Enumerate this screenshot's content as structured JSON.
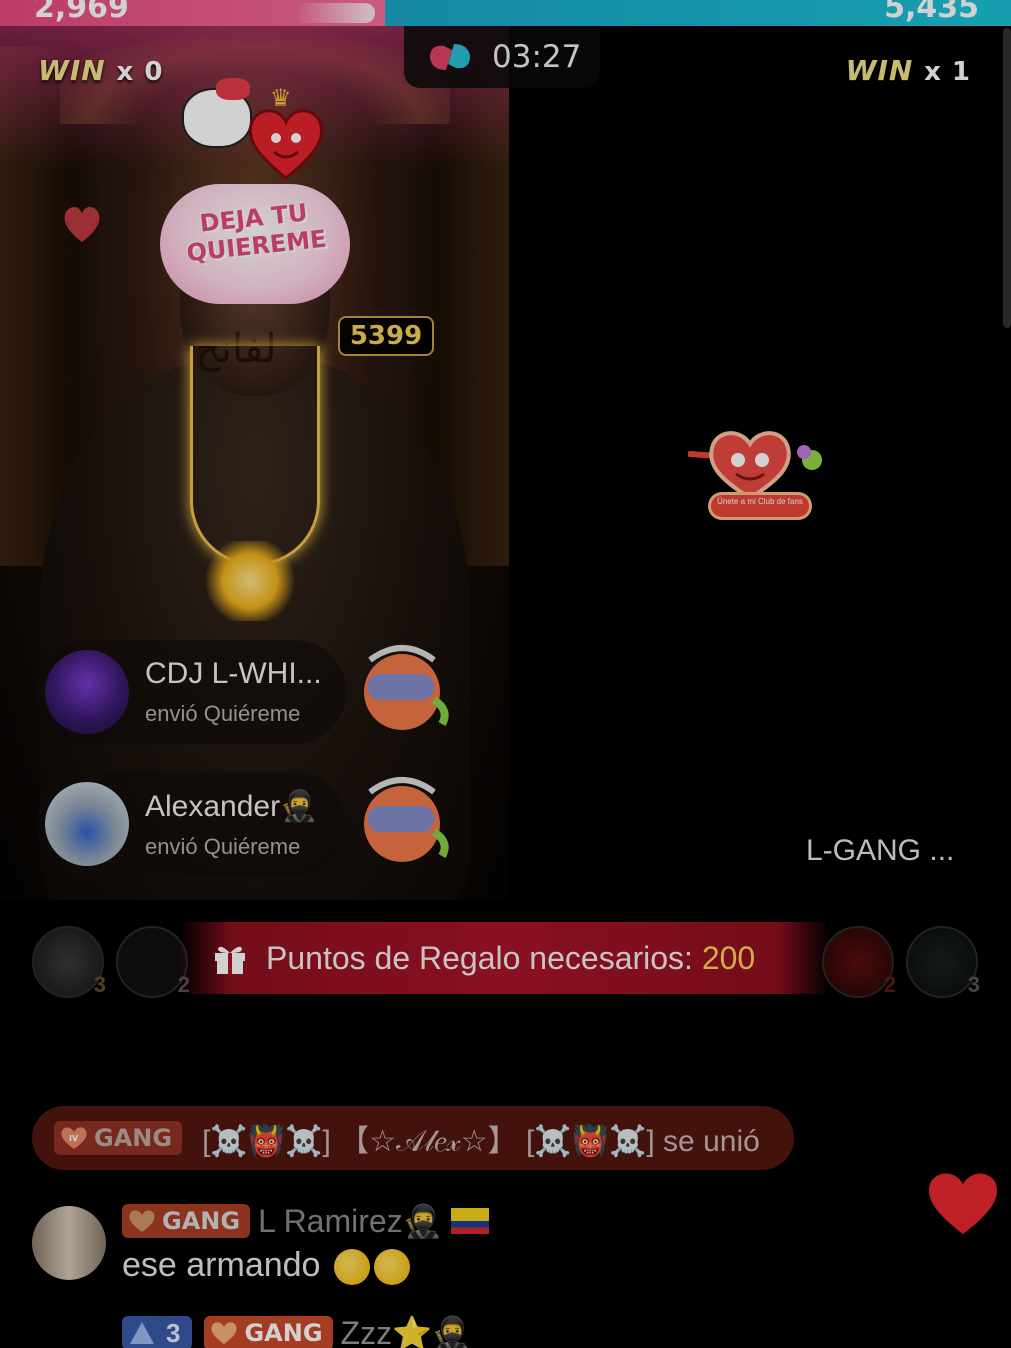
{
  "battle": {
    "left_score": "2,969",
    "right_score": "5,435",
    "left_win_label": "WIN",
    "left_win_count": "x 0",
    "right_win_label": "WIN",
    "right_win_count": "x 1",
    "timer": "03:27",
    "colors": {
      "left": "#e8487f",
      "right": "#1dc2d8"
    }
  },
  "host": {
    "gift_sticker_text": "DEJA TU QUIEREME",
    "combo_count": "5399",
    "neck_tattoo": "لفانح"
  },
  "gift_notifications": [
    {
      "sender": "CDJ L-WHI...",
      "action": "envió Quiéreme",
      "gift_icon": "quiereme-gift-icon"
    },
    {
      "sender": "Alexander🥷",
      "action": "envió Quiéreme",
      "gift_icon": "quiereme-gift-icon"
    }
  ],
  "opponent": {
    "name": "L-GANG ...",
    "sticker_text": "Únete a mi Club de fans"
  },
  "gift_points": {
    "label": "Puntos de Regalo necesarios:",
    "value": "200"
  },
  "top_supporters": {
    "left": [
      {
        "rank": "3"
      },
      {
        "rank": "2"
      }
    ],
    "right": [
      {
        "rank": "2"
      },
      {
        "rank": "3"
      }
    ]
  },
  "joined_banner": {
    "badge_level": "IV",
    "badge_label": "GANG",
    "text": "[☠️👹☠️] 【☆𝒜𝓁𝑒𝓍☆】 [☠️👹☠️] se unió"
  },
  "chat": [
    {
      "badge_label": "GANG",
      "username": "L   Ramirez🥷",
      "flag": "ecuador-flag-icon",
      "message": "ese armando"
    },
    {
      "level": "3",
      "badge_label": "GANG",
      "username": "Zzz⭐🥷"
    }
  ],
  "like_icon": "heart-icon"
}
